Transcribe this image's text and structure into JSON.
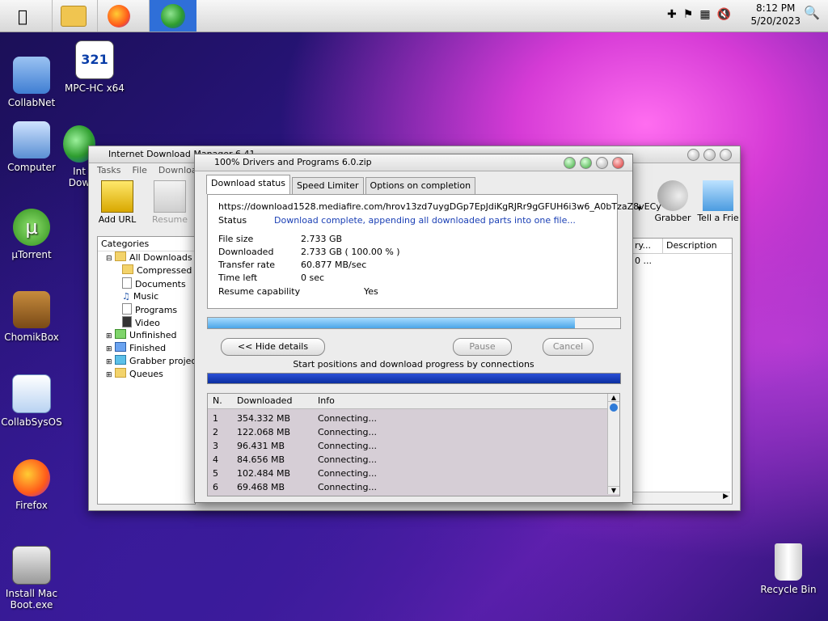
{
  "menubar": {
    "apple": "",
    "launchers": [
      "file-manager",
      "firefox",
      "idm"
    ],
    "clock_time": "8:12 PM",
    "clock_date": "5/20/2023"
  },
  "desktop": {
    "icons": [
      "CollabNet",
      "MPC-HC x64",
      "Computer",
      "Int Dow",
      "µTorrent",
      "ChomikBox",
      "CollabSysOS",
      "Firefox",
      "Install Mac Boot.exe",
      "Recycle Bin"
    ]
  },
  "idm": {
    "title": "Internet Download Manager 6.41",
    "menu": [
      "Tasks",
      "File",
      "Downloads"
    ],
    "toolbar": {
      "add_url": "Add URL",
      "resume": "Resume",
      "grabber": "Grabber",
      "tell": "Tell a Frie"
    },
    "categories_header": "Categories",
    "tree": [
      {
        "label": "All Downloads",
        "level": 0
      },
      {
        "label": "Compressed",
        "level": 1
      },
      {
        "label": "Documents",
        "level": 1
      },
      {
        "label": "Music",
        "level": 1
      },
      {
        "label": "Programs",
        "level": 1
      },
      {
        "label": "Video",
        "level": 1
      },
      {
        "label": "Unfinished",
        "level": 0
      },
      {
        "label": "Finished",
        "level": 0
      },
      {
        "label": "Grabber project",
        "level": 0
      },
      {
        "label": "Queues",
        "level": 0
      }
    ],
    "list_header": [
      "ry...",
      "Description"
    ],
    "list_cell": "0 ..."
  },
  "dialog": {
    "title": "100% Drivers and Programs 6.0.zip",
    "tabs": [
      "Download status",
      "Speed Limiter",
      "Options on completion"
    ],
    "url": "https://download1528.mediafire.com/hrov13zd7uygDGp7EpJdiKgRJRr9gGFUH6i3w6_A0bTzaZ8vECy",
    "status_label": "Status",
    "status_value": "Download complete, appending all downloaded parts into one file...",
    "file_size_label": "File size",
    "file_size_value": "2.733  GB",
    "downloaded_label": "Downloaded",
    "downloaded_value": "2.733  GB  ( 100.00 % )",
    "transfer_label": "Transfer rate",
    "transfer_value": "60.877  MB/sec",
    "timeleft_label": "Time left",
    "timeleft_value": "0 sec",
    "resume_label": "Resume capability",
    "resume_value": "Yes",
    "progress_fraction": 0.89,
    "hide_details": "<< Hide details",
    "pause": "Pause",
    "cancel": "Cancel",
    "connections_caption": "Start positions and download progress by connections",
    "table_headers": [
      "N.",
      "Downloaded",
      "Info"
    ],
    "rows": [
      {
        "n": "1",
        "downloaded": "354.332  MB",
        "info": "Connecting..."
      },
      {
        "n": "2",
        "downloaded": "122.068  MB",
        "info": "Connecting..."
      },
      {
        "n": "3",
        "downloaded": "96.431  MB",
        "info": "Connecting..."
      },
      {
        "n": "4",
        "downloaded": "84.656  MB",
        "info": "Connecting..."
      },
      {
        "n": "5",
        "downloaded": "102.484  MB",
        "info": "Connecting..."
      },
      {
        "n": "6",
        "downloaded": "69.468  MB",
        "info": "Connecting..."
      }
    ]
  }
}
